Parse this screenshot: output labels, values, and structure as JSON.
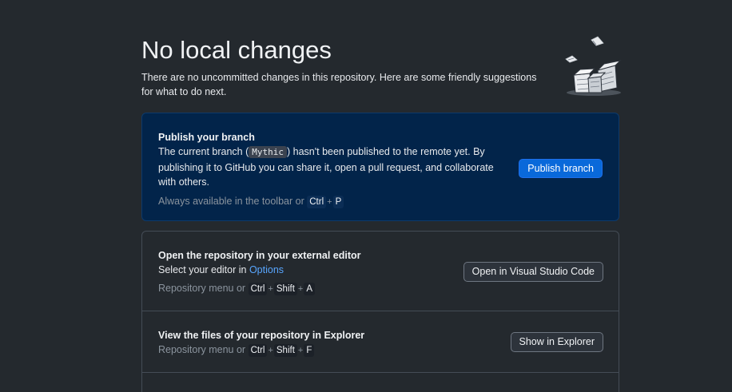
{
  "header": {
    "title": "No local changes",
    "subtitle": "There are no uncommitted changes in this repository. Here are some friendly suggestions for what to do next."
  },
  "illustration": {
    "icon": "empty-boxes-illustration-icon"
  },
  "publish": {
    "title": "Publish your branch",
    "text_before": "The current branch (",
    "branch": "Mythic",
    "text_after": ") hasn't been published to the remote yet. By publishing it to GitHub you can share it, open a pull request, and collaborate with others.",
    "hint_prefix": "Always available in the toolbar or",
    "keys": [
      "Ctrl",
      "P"
    ],
    "plus": "+",
    "button_label": "Publish branch"
  },
  "editor": {
    "title": "Open the repository in your external editor",
    "text_before": "Select your editor in ",
    "link": "Options",
    "hint_prefix": "Repository menu or",
    "keys": [
      "Ctrl",
      "Shift",
      "A"
    ],
    "button_label": "Open in Visual Studio Code"
  },
  "explorer": {
    "title": "View the files of your repository in Explorer",
    "hint_prefix": "Repository menu or",
    "keys": [
      "Ctrl",
      "Shift",
      "F"
    ],
    "button_label": "Show in Explorer"
  },
  "colors": {
    "background": "#24292e",
    "publish_card": "#02244a",
    "primary_button": "#0969da",
    "link": "#58a6ff"
  }
}
